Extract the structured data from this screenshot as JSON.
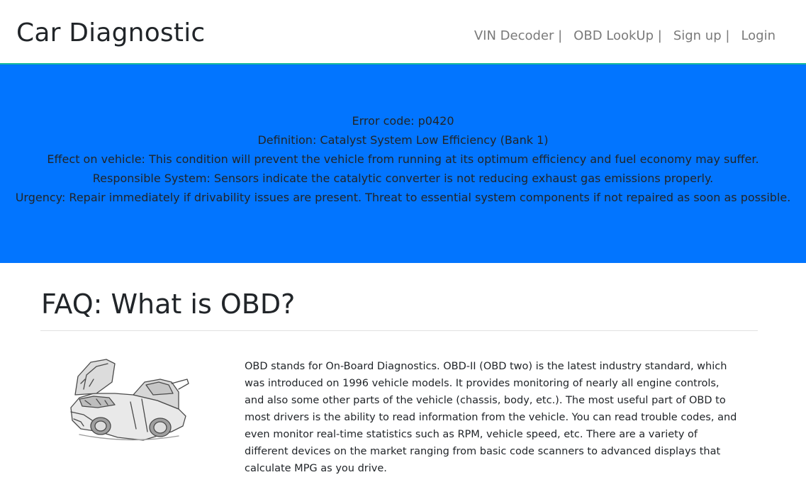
{
  "header": {
    "brand": "Car Diagnostic",
    "nav": [
      {
        "label": "VIN Decoder |"
      },
      {
        "label": "OBD LookUp |"
      },
      {
        "label": "Sign up |"
      },
      {
        "label": "Login"
      }
    ]
  },
  "result": {
    "lines": [
      "Error code: p0420",
      "Definition: Catalyst System Low Efficiency (Bank 1)",
      "Effect on vehicle: This condition will prevent the vehicle from running at its optimum efficiency and fuel economy may suffer.",
      "Responsible System: Sensors indicate the catalytic converter is not reducing exhaust gas emissions properly.",
      "Urgency: Repair immediately if drivability issues are present. Threat to essential system components if not repaired as soon as possible."
    ],
    "background_color": "#0275ff"
  },
  "faq": {
    "title": "FAQ: What is OBD?",
    "image_icon": "car-sketch-icon",
    "body": "OBD stands for On-Board Diagnostics. OBD-II (OBD two) is the latest industry standard, which was introduced on 1996 vehicle models. It provides monitoring of nearly all engine controls, and also some other parts of the vehicle (chassis, body, etc.). The most useful part of OBD to most drivers is the ability to read information from the vehicle. You can read trouble codes, and even monitor real-time statistics such as RPM, vehicle speed, etc. There are a variety of different devices on the market ranging from basic code scanners to advanced displays that calculate MPG as you drive."
  }
}
